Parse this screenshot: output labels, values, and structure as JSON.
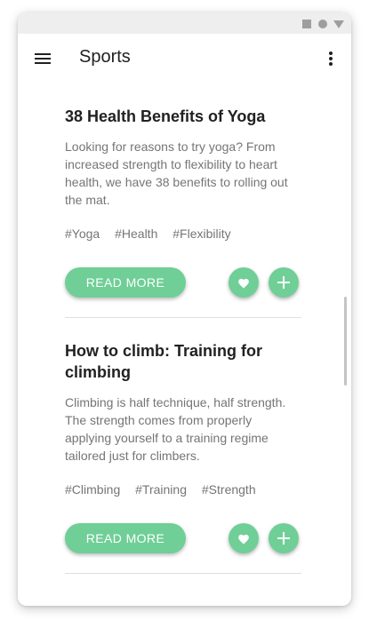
{
  "app_bar": {
    "title": "Sports",
    "menu_icon": "hamburger-menu-icon",
    "more_icon": "more-vert-icon"
  },
  "theme": {
    "accent": "#6fcf97",
    "title_text": "#212121",
    "body_text": "#757575"
  },
  "cards": [
    {
      "title": "38 Health Benefits of Yoga",
      "body": "Looking for reasons to try yoga? From increased strength to flexibility to heart health, we have 38 benefits to rolling out the mat.",
      "tags": [
        "#Yoga",
        "#Health",
        "#Flexibility"
      ],
      "button_label": "READ MORE"
    },
    {
      "title": "How to climb: Training for climbing",
      "body": "Climbing is half technique, half strength. The strength comes from properly applying yourself to a training regime tailored just for climbers.",
      "tags": [
        "#Climbing",
        "#Training",
        "#Strength"
      ],
      "button_label": "READ MORE"
    }
  ]
}
